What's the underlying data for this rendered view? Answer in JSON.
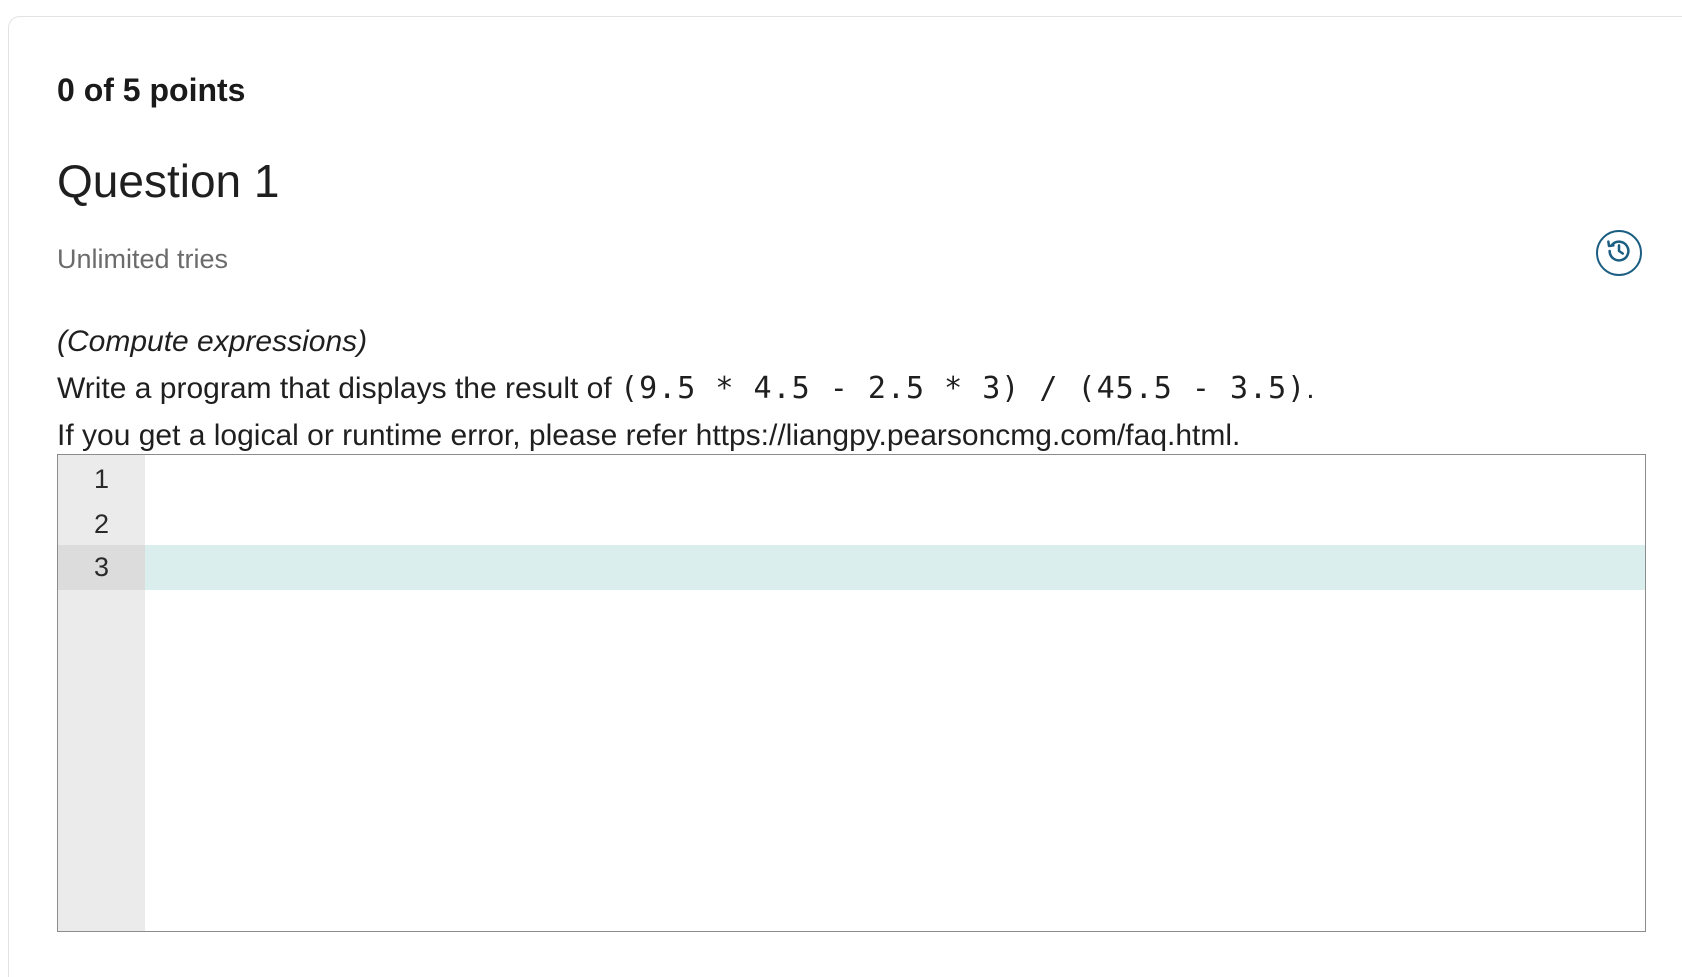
{
  "score": {
    "label": "0 of 5 points"
  },
  "question": {
    "title": "Question 1",
    "tries": "Unlimited tries",
    "history_icon": "history-icon",
    "prompt": {
      "heading": "(Compute expressions)",
      "line1_prefix": "Write a program that displays the result of ",
      "line1_code": "(9.5 * 4.5 - 2.5 * 3) / (45.5 - 3.5)",
      "line1_suffix": ".",
      "line2": "If you get a logical or runtime error, please refer https://liangpy.pearsoncmg.com/faq.html."
    }
  },
  "editor": {
    "line_numbers": [
      "1",
      "2",
      "3"
    ],
    "lines": [
      "",
      "",
      ""
    ],
    "active_line": 3
  },
  "colors": {
    "accent": "#1b5e82",
    "active_line_bg": "#dbeeee",
    "gutter_bg": "#ebebeb"
  }
}
